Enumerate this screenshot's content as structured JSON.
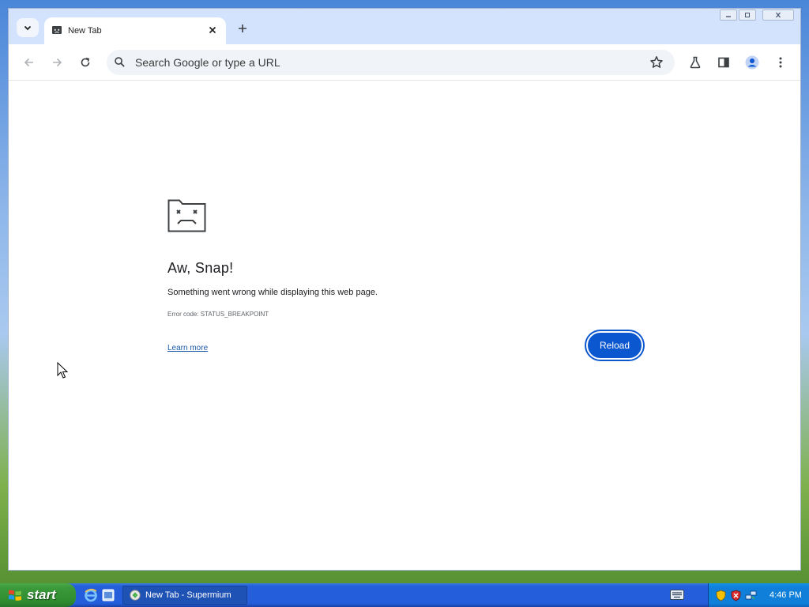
{
  "browser": {
    "tab": {
      "title": "New Tab"
    },
    "omnibox": {
      "placeholder": "Search Google or type a URL"
    }
  },
  "error_page": {
    "title": "Aw, Snap!",
    "message": "Something went wrong while displaying this web page.",
    "code": "Error code: STATUS_BREAKPOINT",
    "learn_more": "Learn more",
    "reload": "Reload"
  },
  "taskbar": {
    "start": "start",
    "task_item": "New Tab - Supermium",
    "clock": "4:46 PM"
  },
  "colors": {
    "accent": "#0b57d0",
    "tabstrip": "#d3e3fd",
    "taskbar": "#245edb",
    "start": "#2f8a2f"
  }
}
